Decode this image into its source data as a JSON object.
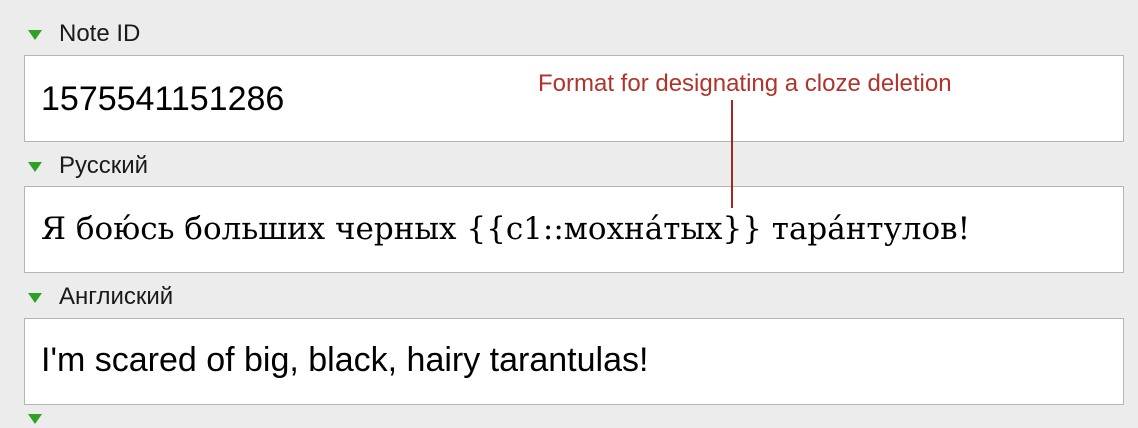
{
  "fields": [
    {
      "name": "Note ID",
      "value": "1575541151286"
    },
    {
      "name": "Русский",
      "value": "Я бою́сь больших черных {{c1::мохна́тых}} тара́нтулов!"
    },
    {
      "name": "Англиский",
      "value": "I'm scared of big, black, hairy tarantulas!"
    },
    {
      "name": "",
      "value": ""
    }
  ],
  "annotation": {
    "text": "Format for designating a cloze deletion",
    "color": "#b2332b"
  },
  "colors": {
    "background": "#ececec",
    "triangle": "#2ea023",
    "field_border": "#b5b5b5"
  }
}
